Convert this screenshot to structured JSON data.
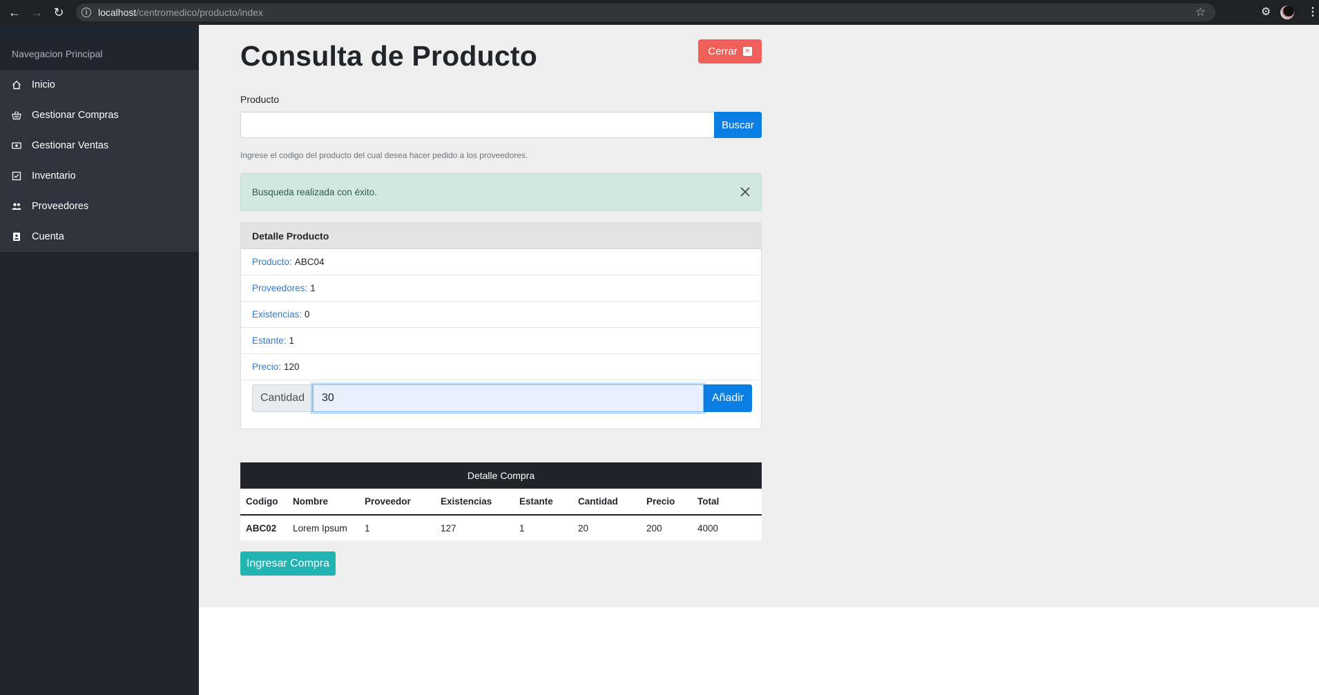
{
  "browser": {
    "url_host": "localhost",
    "url_path": "/centromedico/producto/index"
  },
  "sidebar": {
    "heading": "Navegacion Principal",
    "items": [
      {
        "label": "Inicio",
        "icon": "home-icon"
      },
      {
        "label": "Gestionar Compras",
        "icon": "basket-icon"
      },
      {
        "label": "Gestionar Ventas",
        "icon": "money-icon"
      },
      {
        "label": "Inventario",
        "icon": "checklist-icon"
      },
      {
        "label": "Proveedores",
        "icon": "users-icon"
      },
      {
        "label": "Cuenta",
        "icon": "id-card-icon"
      }
    ]
  },
  "main": {
    "title": "Consulta de Producto",
    "close_label": "Cerrar",
    "field_label": "Producto",
    "search_value": "",
    "search_button": "Buscar",
    "help_text": "Ingrese el codigo del producto del cual desea hacer pedido a los proveedores.",
    "alert_text": "Busqueda realizada con éxito."
  },
  "detail": {
    "header": "Detalle Producto",
    "rows": [
      {
        "key": "Producto:",
        "value": "ABC04"
      },
      {
        "key": "Proveedores:",
        "value": "1"
      },
      {
        "key": "Existencias:",
        "value": "0"
      },
      {
        "key": "Estante:",
        "value": "1"
      },
      {
        "key": "Precio:",
        "value": "120"
      }
    ],
    "qty_label": "Cantidad",
    "qty_value": "30",
    "add_button": "Añadir"
  },
  "purchase": {
    "caption": "Detalle Compra",
    "columns": [
      "Codigo",
      "Nombre",
      "Proveedor",
      "Existencias",
      "Estante",
      "Cantidad",
      "Precio",
      "Total"
    ],
    "rows": [
      [
        "ABC02",
        "Lorem Ipsum",
        "1",
        "127",
        "1",
        "20",
        "200",
        "4000"
      ]
    ],
    "submit_button": "Ingresar Compra"
  },
  "colors": {
    "sidebar_bg": "#202630",
    "primary": "#0b7ee3",
    "danger": "#f05f5a",
    "success_alert": "#d2e7e0",
    "teal": "#22b3b3"
  }
}
